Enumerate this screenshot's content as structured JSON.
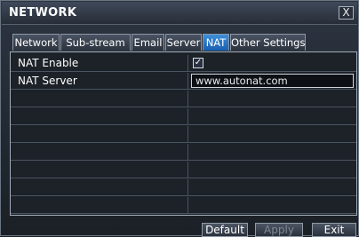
{
  "window": {
    "title": "NETWORK",
    "close_label": "X"
  },
  "tabs": [
    {
      "label": "Network"
    },
    {
      "label": "Sub-stream"
    },
    {
      "label": "Email"
    },
    {
      "label": "Server"
    },
    {
      "label": "NAT",
      "active": true
    },
    {
      "label": "Other Settings"
    }
  ],
  "settings": {
    "nat_enable": {
      "label": "NAT Enable",
      "checked": true,
      "check_glyph": "✓"
    },
    "nat_server": {
      "label": "NAT Server",
      "value": "www.autonat.com"
    }
  },
  "buttons": {
    "default_label": "Default",
    "apply_label": "Apply",
    "exit_label": "Exit"
  }
}
